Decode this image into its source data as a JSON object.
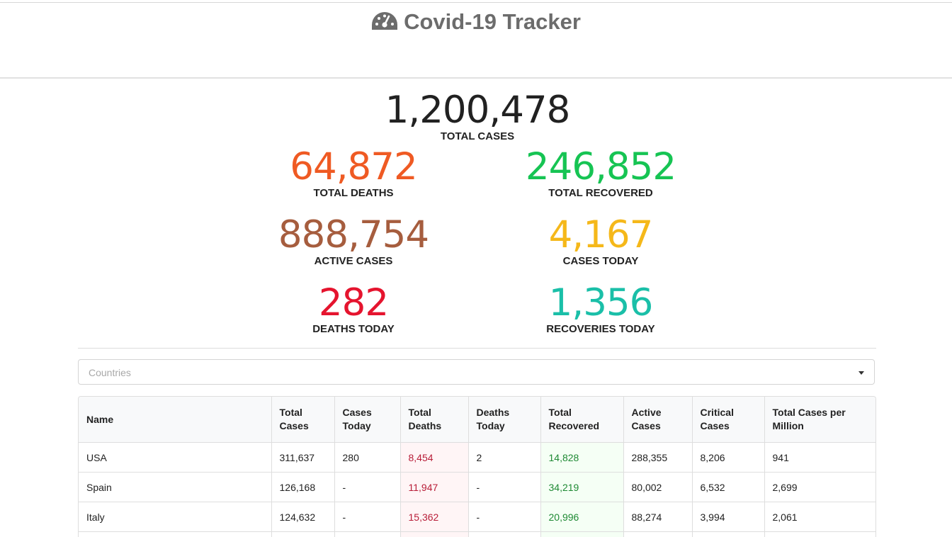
{
  "header": {
    "title": "Covid-19 Tracker",
    "icon": "gauge-icon"
  },
  "stats": {
    "total_cases": {
      "value": "1,200,478",
      "label": "TOTAL CASES",
      "color": "#212121"
    },
    "total_deaths": {
      "value": "64,872",
      "label": "TOTAL DEATHS",
      "color": "#ef5a23"
    },
    "total_recovered": {
      "value": "246,852",
      "label": "TOTAL RECOVERED",
      "color": "#16c453"
    },
    "active_cases": {
      "value": "888,754",
      "label": "ACTIVE CASES",
      "color": "#a65d3e"
    },
    "cases_today": {
      "value": "4,167",
      "label": "CASES TODAY",
      "color": "#f5b81a"
    },
    "deaths_today": {
      "value": "282",
      "label": "DEATHS TODAY",
      "color": "#e5142e"
    },
    "recoveries_today": {
      "value": "1,356",
      "label": "RECOVERIES TODAY",
      "color": "#1abfa8"
    }
  },
  "country_select": {
    "placeholder": "Countries"
  },
  "table": {
    "headers": {
      "name": "Name",
      "total_cases": "Total Cases",
      "cases_today": "Cases Today",
      "total_deaths": "Total Deaths",
      "deaths_today": "Deaths Today",
      "total_recovered": "Total Recovered",
      "active_cases": "Active Cases",
      "critical_cases": "Critical Cases",
      "per_million": "Total Cases per Million"
    },
    "rows": [
      {
        "name": "USA",
        "total_cases": "311,637",
        "cases_today": "280",
        "total_deaths": "8,454",
        "deaths_today": "2",
        "total_recovered": "14,828",
        "active_cases": "288,355",
        "critical_cases": "8,206",
        "per_million": "941"
      },
      {
        "name": "Spain",
        "total_cases": "126,168",
        "cases_today": "-",
        "total_deaths": "11,947",
        "deaths_today": "-",
        "total_recovered": "34,219",
        "active_cases": "80,002",
        "critical_cases": "6,532",
        "per_million": "2,699"
      },
      {
        "name": "Italy",
        "total_cases": "124,632",
        "cases_today": "-",
        "total_deaths": "15,362",
        "deaths_today": "-",
        "total_recovered": "20,996",
        "active_cases": "88,274",
        "critical_cases": "3,994",
        "per_million": "2,061"
      }
    ]
  }
}
